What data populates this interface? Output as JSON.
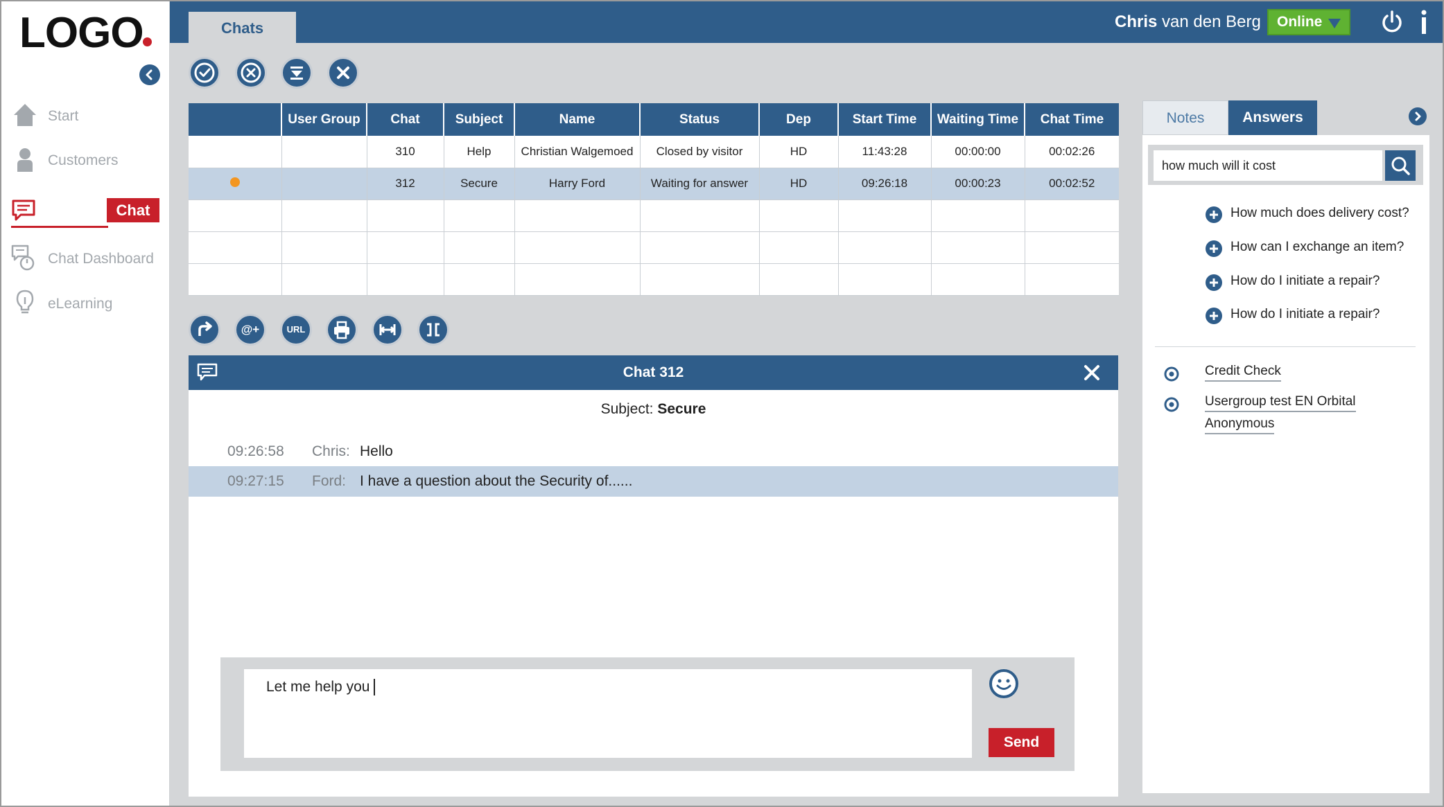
{
  "logo": {
    "text": "LOGO"
  },
  "colors": {
    "primary": "#2f5d8a",
    "accent": "#c8202a",
    "online": "#5fb232",
    "selection": "#c2d2e3",
    "indicator": "#f39620"
  },
  "sidebar": {
    "items": [
      {
        "label": "Start",
        "icon": "home-icon"
      },
      {
        "label": "Customers",
        "icon": "person-icon"
      },
      {
        "label": "Chat",
        "icon": "chat-bubble-icon",
        "active": true
      },
      {
        "label": "Chat Dashboard",
        "icon": "chat-dashboard-icon"
      },
      {
        "label": "eLearning",
        "icon": "lightbulb-icon"
      }
    ]
  },
  "topbar": {
    "tab_label": "Chats",
    "user_first": "Chris",
    "user_rest": "van den Berg",
    "status": "Online"
  },
  "table": {
    "columns": [
      "",
      "User Group",
      "Chat",
      "Subject",
      "Name",
      "Status",
      "Dep",
      "Start Time",
      "Waiting Time",
      "Chat Time"
    ],
    "rows": [
      {
        "chat": "310",
        "subject": "Help",
        "name": "Christian Walgemoed",
        "status": "Closed by visitor",
        "dep": "HD",
        "start": "11:43:28",
        "waiting": "00:00:00",
        "chat_time": "00:02:26"
      },
      {
        "chat": "312",
        "subject": "Secure",
        "name": "Harry Ford",
        "status": "Waiting for answer",
        "dep": "HD",
        "start": "09:26:18",
        "waiting": "00:00:23",
        "chat_time": "00:02:52"
      }
    ]
  },
  "chat": {
    "title": "Chat 312",
    "subject_label": "Subject:",
    "subject": "Secure",
    "messages": [
      {
        "time": "09:26:58",
        "author": "Chris:",
        "text": "Hello"
      },
      {
        "time": "09:27:15",
        "author": "Ford:",
        "text": "I have a question about the Security of......"
      }
    ],
    "draft": "Let me help you",
    "send_label": "Send",
    "url_label": "URL",
    "mention_label": "@+"
  },
  "rpanel": {
    "tab_notes": "Notes",
    "tab_answers": "Answers",
    "search_value": "how much will it cost",
    "faqs": [
      "How much does delivery cost?",
      "How can I exchange an item?",
      "How do I initiate a repair?",
      "How do I initiate a repair?"
    ],
    "links": [
      "Credit Check",
      "Usergroup test EN Orbital",
      "Anonymous"
    ]
  }
}
